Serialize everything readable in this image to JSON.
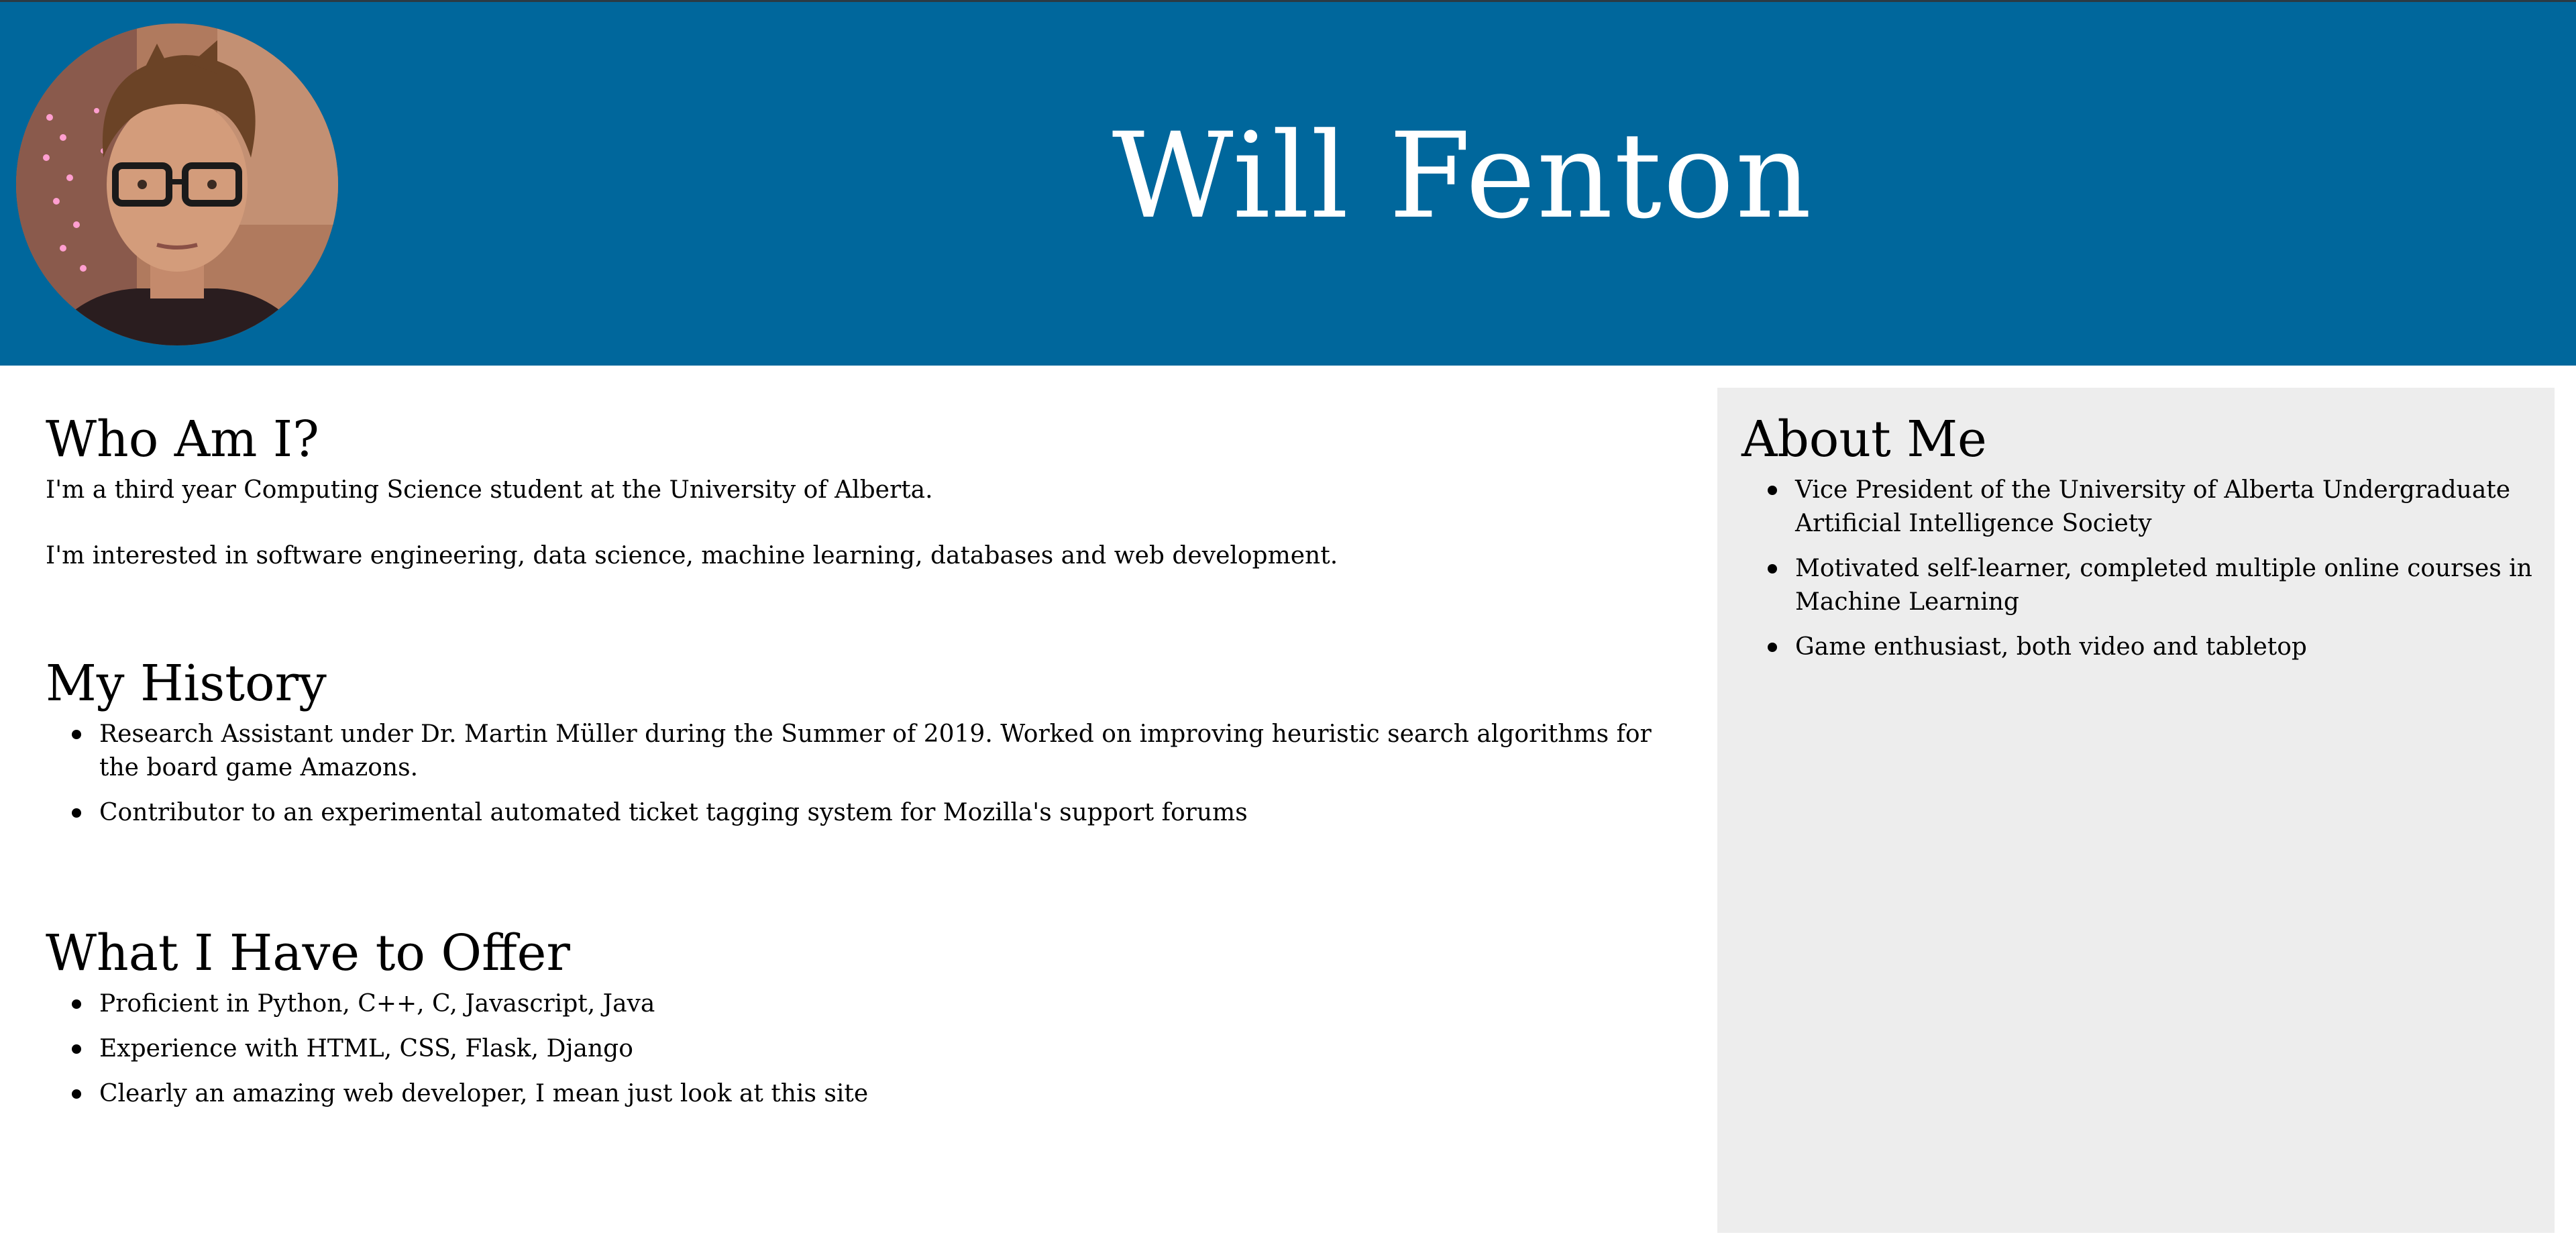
{
  "header": {
    "name": "Will Fenton",
    "avatar_icon": "profile-photo"
  },
  "who": {
    "heading": "Who Am I?",
    "paragraphs": [
      "I'm a third year Computing Science student at the University of Alberta.",
      "I'm interested in software engineering, data science, machine learning, databases and web development."
    ]
  },
  "history": {
    "heading": "My History",
    "items": [
      "Research Assistant under Dr. Martin Müller during the Summer of 2019. Worked on improving heuristic search algorithms for the board game Amazons.",
      "Contributor to an experimental automated ticket tagging system for Mozilla's support forums"
    ]
  },
  "offer": {
    "heading": "What I Have to Offer",
    "items": [
      "Proficient in Python, C++, C, Javascript, Java",
      "Experience with HTML, CSS, Flask, Django",
      "Clearly an amazing web developer, I mean just look at this site"
    ]
  },
  "about": {
    "heading": "About Me",
    "items": [
      "Vice President of the University of Alberta Undergraduate Artificial Intelligence Society",
      "Motivated self-learner, completed multiple online courses in Machine Learning",
      "Game enthusiast, both video and tabletop"
    ]
  },
  "colors": {
    "header_bg": "#00679c",
    "aside_bg": "#ededed",
    "title_color": "#ffffff"
  }
}
